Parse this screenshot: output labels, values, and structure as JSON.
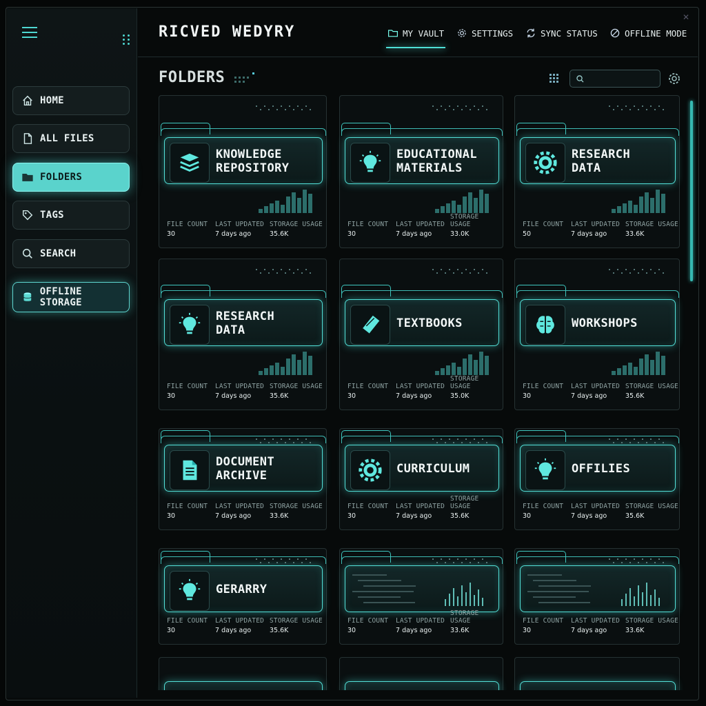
{
  "header": {
    "brand": "RICVED WEDYRY",
    "nav": [
      {
        "label": "MY VAULT",
        "icon": "folder-icon"
      },
      {
        "label": "SETTINGS",
        "icon": "gear-icon"
      },
      {
        "label": "SYNC STATUS",
        "icon": "sync-icon"
      },
      {
        "label": "OFFLINE MODE",
        "icon": "offline-icon"
      }
    ]
  },
  "sidebar": {
    "items": [
      {
        "label": "HOME",
        "icon": "home-icon"
      },
      {
        "label": "ALL FILES",
        "icon": "file-icon"
      },
      {
        "label": "FOLDERS",
        "icon": "folder-icon"
      },
      {
        "label": "TAGS",
        "icon": "tag-icon"
      },
      {
        "label": "SEARCH",
        "icon": "search-icon"
      },
      {
        "label": "OFFLINE STORAGE",
        "icon": "database-icon"
      }
    ]
  },
  "main": {
    "title": "FOLDERS",
    "search_placeholder": "",
    "meta_labels": {
      "file_count": "FILE COUNT",
      "last_updated": "LAST UPDATED",
      "storage_usage": "STORAGE USAGE"
    },
    "folders": [
      {
        "name1": "KNOWLEDGE",
        "name2": "REPOSITORY",
        "icon": "stack-icon",
        "file_count": "30",
        "last_updated": "7 days ago",
        "storage": "35.6K"
      },
      {
        "name1": "EDUCATIONAL",
        "name2": "MATERIALS",
        "icon": "lightbulb-icon",
        "file_count": "30",
        "last_updated": "7 days ago",
        "storage": "33.0K"
      },
      {
        "name1": "RESEARCH",
        "name2": "DATA",
        "icon": "gear-icon",
        "file_count": "50",
        "last_updated": "7 days ago",
        "storage": "33.6K"
      },
      {
        "name1": "RESEARCH",
        "name2": "DATA",
        "icon": "lightbulb-icon",
        "file_count": "30",
        "last_updated": "7 days ago",
        "storage": "35.6K"
      },
      {
        "name1": "TEXTBOOKS",
        "name2": "",
        "icon": "book-icon",
        "file_count": "30",
        "last_updated": "7 days ago",
        "storage": "35.0K"
      },
      {
        "name1": "WORKSHOPS",
        "name2": "",
        "icon": "brain-icon",
        "file_count": "30",
        "last_updated": "7 days ago",
        "storage": "35.6K"
      },
      {
        "name1": "DOCUMENT",
        "name2": "ARCHIVE",
        "icon": "document-icon",
        "file_count": "30",
        "last_updated": "7 days ago",
        "storage": "33.6K"
      },
      {
        "name1": "CURRICULUM",
        "name2": "",
        "icon": "gear-icon",
        "file_count": "30",
        "last_updated": "7 days ago",
        "storage": "35.6K"
      },
      {
        "name1": "OFFILIES",
        "name2": "",
        "icon": "lightbulb-icon",
        "file_count": "30",
        "last_updated": "7 days ago",
        "storage": "35.6K"
      },
      {
        "name1": "GERARRY",
        "name2": "",
        "icon": "lightbulb-icon",
        "file_count": "30",
        "last_updated": "7 days ago",
        "storage": "35.6K"
      },
      {
        "name1": "",
        "name2": "",
        "icon": "",
        "file_count": "30",
        "last_updated": "7 days ago",
        "storage": "33.6K"
      },
      {
        "name1": "",
        "name2": "",
        "icon": "",
        "file_count": "30",
        "last_updated": "7 days ago",
        "storage": "33.6K"
      }
    ]
  },
  "colors": {
    "accent": "#4fe0d8",
    "background": "#070a0a",
    "panel": "#0a0f10"
  }
}
